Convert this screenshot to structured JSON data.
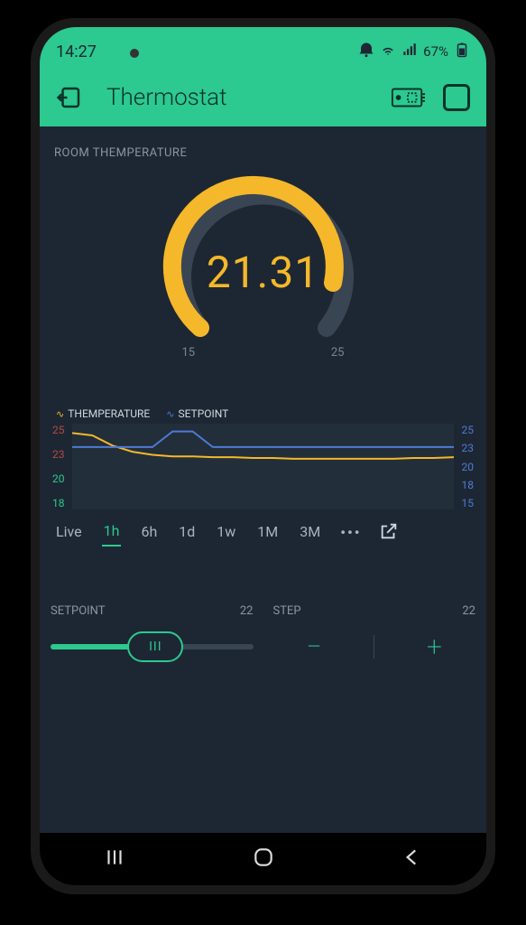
{
  "statusbar": {
    "time": "14:27",
    "battery": "67%"
  },
  "titlebar": {
    "title": "Thermostat"
  },
  "gauge": {
    "label": "ROOM THEMPERATURE",
    "value": "21.31",
    "min": "15",
    "max": "25"
  },
  "chart_data": {
    "type": "line",
    "series": [
      {
        "name": "THEMPERATURE",
        "color": "#f5b82a",
        "values": [
          24.8,
          24.5,
          23.2,
          22.4,
          22.0,
          21.8,
          21.8,
          21.7,
          21.7,
          21.6,
          21.6,
          21.5,
          21.5,
          21.5,
          21.5,
          21.5,
          21.5,
          21.6,
          21.6,
          21.7
        ]
      },
      {
        "name": "SETPOINT",
        "color": "#4d7bd6",
        "values": [
          23,
          23,
          23,
          23,
          23,
          25,
          25,
          23,
          23,
          23,
          23,
          23,
          23,
          23,
          23,
          23,
          23,
          23,
          23,
          23
        ]
      }
    ],
    "left_ticks": [
      "25",
      "23",
      "20",
      "18"
    ],
    "right_ticks": [
      "25",
      "23",
      "20",
      "18",
      "15"
    ],
    "ylim": [
      15,
      26
    ]
  },
  "time_tabs": {
    "items": [
      "Live",
      "1h",
      "6h",
      "1d",
      "1w",
      "1M",
      "3M"
    ],
    "active": "1h",
    "more": "•••"
  },
  "setpoint": {
    "label": "SETPOINT",
    "value": "22"
  },
  "step": {
    "label": "STEP",
    "value": "22"
  }
}
